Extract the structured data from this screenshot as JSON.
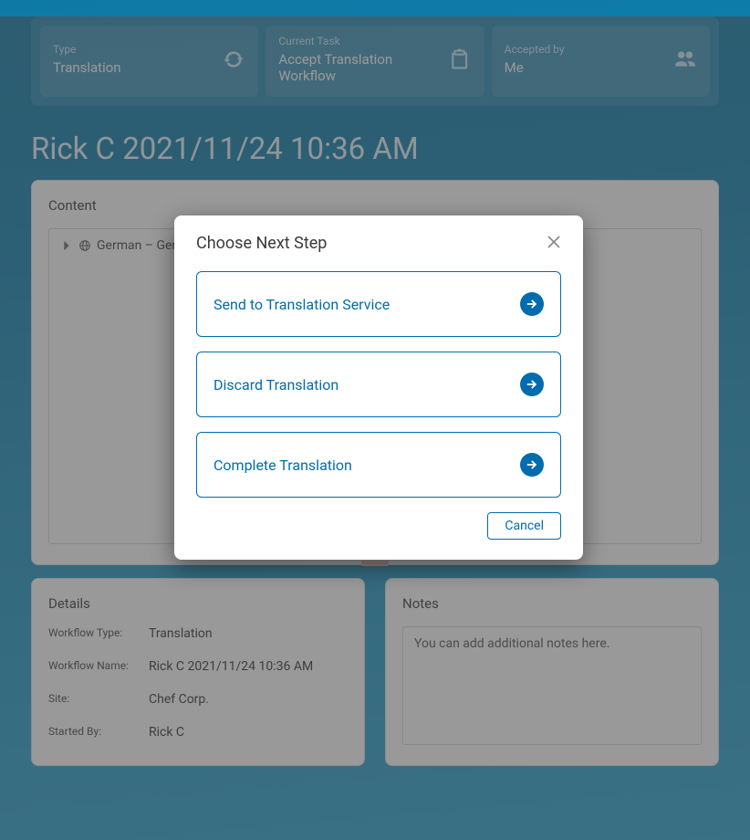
{
  "summary": {
    "type": {
      "label": "Type",
      "value": "Translation"
    },
    "task": {
      "label": "Current Task",
      "value": "Accept Translation Workflow"
    },
    "accepted": {
      "label": "Accepted by",
      "value": "Me"
    }
  },
  "page_title": "Rick C 2021/11/24 10:36 AM",
  "content": {
    "title": "Content",
    "item": "German – Germany"
  },
  "details": {
    "title": "Details",
    "rows": {
      "workflow_type": {
        "k": "Workflow Type:",
        "v": "Translation"
      },
      "workflow_name": {
        "k": "Workflow Name:",
        "v": "Rick C 2021/11/24 10:36 AM"
      },
      "site": {
        "k": "Site:",
        "v": "Chef Corp."
      },
      "started_by": {
        "k": "Started By:",
        "v": "Rick C"
      }
    }
  },
  "notes": {
    "title": "Notes",
    "placeholder": "You can add additional notes here."
  },
  "modal": {
    "title": "Choose Next Step",
    "steps": {
      "send": "Send to Translation Service",
      "discard": "Discard Translation",
      "complete": "Complete Translation"
    },
    "cancel": "Cancel"
  }
}
